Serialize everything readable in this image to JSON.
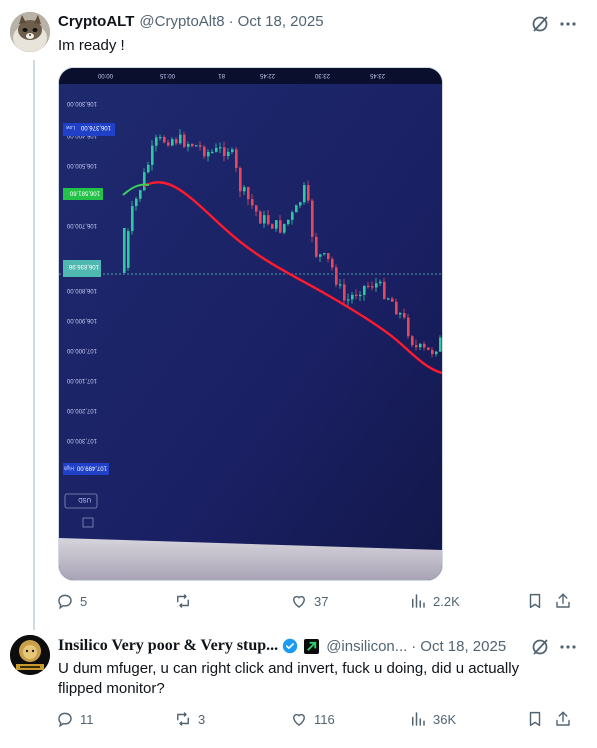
{
  "tweet1": {
    "name": "CryptoALT",
    "handle": "@CryptoAlt8",
    "separator": "·",
    "date": "Oct 18, 2025",
    "text": "Im ready !",
    "stats": {
      "replies": "5",
      "reposts": "",
      "likes": "37",
      "views": "2.2K"
    },
    "chart_labels": {
      "time_ticks": [
        "00:00",
        "00:15",
        "81",
        "22:45",
        "23:30",
        "23:45"
      ],
      "price_ticks": [
        "106,300.00",
        "106,300.00",
        "106,400.00",
        "106,500.00",
        "106,600.00",
        "106,700.00",
        "106,800.00",
        "106,900.00",
        "107,000.00",
        "107,100.00",
        "107,200.00",
        "107,300.00",
        "107,400.00"
      ],
      "low_tag_label": "Low",
      "low_tag_value": "106,376.00",
      "green_tag": "106,581.60",
      "last_price_tag": "106,836.96",
      "high_tag_label": "High",
      "high_tag_value": "107,499.00",
      "currency": "USD"
    }
  },
  "tweet2": {
    "name": "Insilico Very poor & Very stup...",
    "handle": "@insilicon...",
    "separator": "·",
    "date": "Oct 18, 2025",
    "text": "U dum mfuger, u can right click and invert, fuck u doing, did u actually flipped monitor?",
    "stats": {
      "replies": "11",
      "reposts": "3",
      "likes": "116",
      "views": "36K"
    }
  },
  "colors": {
    "text_primary": "#0f1419",
    "text_secondary": "#536471",
    "verified_blue": "#1d9bf0",
    "chart_bg": "#1b2160",
    "up_candle": "#2ec9a0",
    "down_candle": "#e8485b",
    "ma_line": "#ff1a2e"
  },
  "icons": [
    "grok-icon",
    "more-icon",
    "reply-icon",
    "repost-icon",
    "like-icon",
    "views-icon",
    "bookmark-icon",
    "share-icon",
    "verified-icon",
    "affiliate-badge-icon"
  ]
}
